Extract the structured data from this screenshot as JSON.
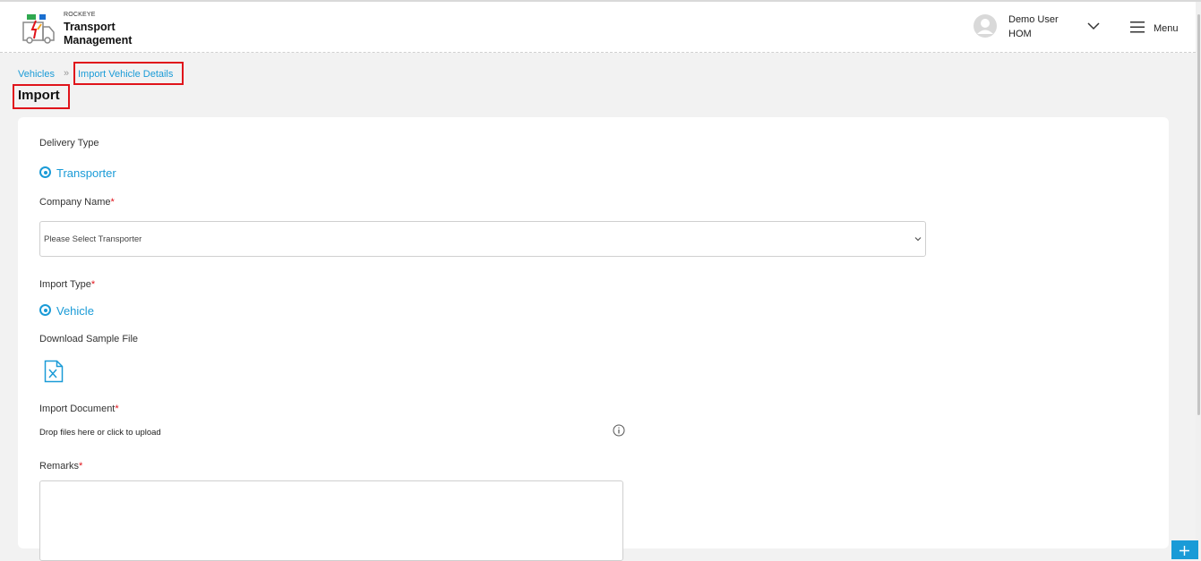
{
  "header": {
    "brand_small": "ROCKEYE",
    "brand_line1": "Transport",
    "brand_line2": "Management",
    "user_name": "Demo User",
    "user_role": "HOM",
    "menu_label": "Menu"
  },
  "breadcrumb": {
    "items": [
      "Vehicles",
      "Import Vehicle Details"
    ]
  },
  "page_title": "Import",
  "form": {
    "delivery_type_label": "Delivery Type",
    "delivery_type_option": "Transporter",
    "company_name_label": "Company Name",
    "company_name_placeholder": "Please Select Transporter",
    "import_type_label": "Import Type",
    "import_type_option": "Vehicle",
    "download_sample_label": "Download Sample File",
    "import_document_label": "Import Document",
    "dropzone_text": "Drop files here or click to upload",
    "remarks_label": "Remarks",
    "required_marker": "*"
  },
  "colors": {
    "accent": "#1a9bd7",
    "required": "#e0141b",
    "highlight": "#e0141b"
  },
  "icons": {
    "sample_file": "excel-file-icon",
    "info": "info-icon",
    "menu": "hamburger-icon",
    "avatar": "user-avatar-icon",
    "fab": "plus-icon"
  }
}
